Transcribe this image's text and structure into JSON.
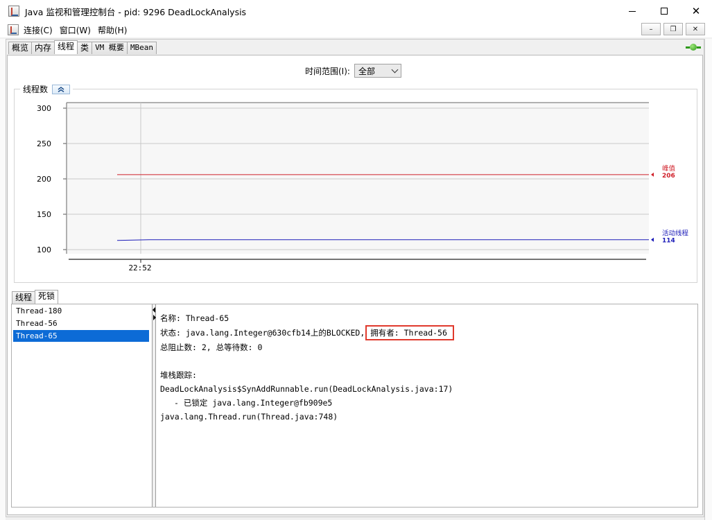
{
  "window": {
    "title": "Java 监视和管理控制台 - pid: 9296 DeadLockAnalysis",
    "minimize_glyph": "",
    "maximize_glyph": "",
    "close_glyph": "✕"
  },
  "menubar": {
    "items": [
      {
        "label": "连接(C)"
      },
      {
        "label": "窗口(W)"
      },
      {
        "label": "帮助(H)"
      }
    ],
    "mdi_minimize": "–",
    "mdi_restore": "❐",
    "mdi_close": "✕"
  },
  "tabs": [
    {
      "label": "概览",
      "active": false
    },
    {
      "label": "内存",
      "active": false
    },
    {
      "label": "线程",
      "active": true
    },
    {
      "label": "类",
      "active": false
    },
    {
      "label": "VM 概要",
      "active": false
    },
    {
      "label": "MBean",
      "active": false
    }
  ],
  "time_range": {
    "label": "时间范围(I):",
    "value": "全部"
  },
  "chart_data": {
    "type": "line",
    "title": "线程数",
    "x_tick_labels": [
      "22:52"
    ],
    "ylim": [
      100,
      300
    ],
    "y_ticks": [
      100,
      150,
      200,
      250,
      300
    ],
    "grid": true,
    "series": [
      {
        "name": "峰值",
        "color": "#d0202a",
        "x": [
          0,
          1
        ],
        "y": [
          206,
          206
        ],
        "current": "206"
      },
      {
        "name": "活动线程",
        "color": "#1b1bb8",
        "x": [
          0,
          0.06,
          1
        ],
        "y": [
          113,
          114,
          114
        ],
        "current": "114"
      }
    ]
  },
  "subtabs": [
    {
      "label": "线程",
      "active": false
    },
    {
      "label": "死锁",
      "active": true
    }
  ],
  "threads": [
    {
      "name": "Thread-180",
      "selected": false
    },
    {
      "name": "Thread-56",
      "selected": false
    },
    {
      "name": "Thread-65",
      "selected": true
    }
  ],
  "detail": {
    "name_line": "名称: Thread-65",
    "state_line": "状态: java.lang.Integer@630cfb14上的BLOCKED,",
    "owner": "拥有者: Thread-56",
    "counts_line": "总阻止数: 2, 总等待数: 0",
    "stack_title": "堆栈跟踪:",
    "stack": [
      "DeadLockAnalysis$SynAddRunnable.run(DeadLockAnalysis.java:17)",
      "- 已锁定 java.lang.Integer@fb909e5",
      "java.lang.Thread.run(Thread.java:748)"
    ]
  }
}
